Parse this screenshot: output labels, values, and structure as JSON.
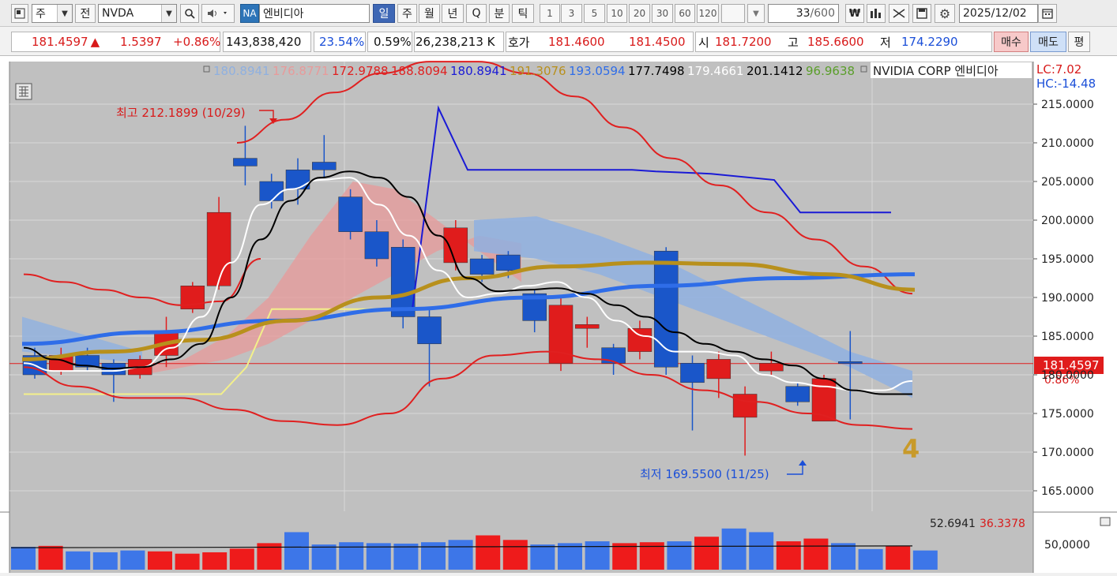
{
  "toolbar": {
    "period_type": "주",
    "prev_label": "전",
    "symbol": "NVDA",
    "exchange_badge": "NA",
    "stock_name": "엔비디아",
    "period_tabs": [
      "일",
      "주",
      "월",
      "년",
      "Q",
      "분",
      "틱"
    ],
    "active_period": "일",
    "intervals": [
      "1",
      "3",
      "5",
      "10",
      "20",
      "30",
      "60",
      "120"
    ],
    "count": "33",
    "count_max": "/600",
    "date": "2025/12/02"
  },
  "quote": {
    "price": "181.4597",
    "change_arrow": "▲",
    "change": "1.5397",
    "change_pct": "+0.86%",
    "volume": "143,838,420",
    "vol_ratio": "23.54%",
    "turnover_ratio": "0.59%",
    "amount": "26,238,213 K",
    "hoga_label": "호가",
    "ask": "181.4600",
    "bid": "181.4500",
    "open_label": "시",
    "open": "181.7200",
    "high_label": "고",
    "high": "185.6600",
    "low_label": "저",
    "low": "174.2290",
    "buy_label": "매수",
    "sell_label": "매도",
    "avg_label": "평"
  },
  "legend": {
    "items": [
      {
        "text": "180.8941",
        "color": "#8fb0e0"
      },
      {
        "text": "176.8771",
        "color": "#e89a9a"
      },
      {
        "text": "172.9788",
        "color": "#e02020"
      },
      {
        "text": "188.8094",
        "color": "#e02020"
      },
      {
        "text": "180.8941",
        "color": "#1a1ad6"
      },
      {
        "text": "191.3076",
        "color": "#b8901c"
      },
      {
        "text": "193.0594",
        "color": "#2f6de8"
      },
      {
        "text": "177.7498",
        "color": "#000000"
      },
      {
        "text": "179.4661",
        "color": "#ffffff"
      },
      {
        "text": "201.1412",
        "color": "#000000"
      },
      {
        "text": "96.9638",
        "color": "#5a9e2a"
      }
    ],
    "name": "NVIDIA CORP  엔비디아",
    "lc": "LC:7.02",
    "hc": "HC:-14.48"
  },
  "annotations": {
    "high": "최고 212.1899 (10/29)",
    "low": "최저 169.5500 (11/25)",
    "count_mark": "4",
    "price_tag": "181.4597",
    "pct_tag": "0.86%"
  },
  "volume_legend": {
    "v1": "52.6941",
    "v2": "36.3378",
    "axis_label": "50,0000"
  },
  "chart_data": {
    "type": "candlestick",
    "ylim": [
      162,
      222
    ],
    "yticks": [
      "215.0000",
      "210.0000",
      "205.0000",
      "200.0000",
      "195.0000",
      "190.0000",
      "185.0000",
      "180.0000",
      "175.0000",
      "170.0000",
      "165.0000"
    ],
    "ytick_values": [
      215,
      210,
      205,
      200,
      195,
      190,
      185,
      180,
      175,
      170,
      165
    ],
    "last_price": 181.4597,
    "candles": [
      {
        "o": 182.5,
        "c": 180.0,
        "h": 183.5,
        "l": 179.5
      },
      {
        "o": 180.5,
        "c": 182.5,
        "h": 183.5,
        "l": 180.0
      },
      {
        "o": 182.5,
        "c": 181.0,
        "h": 183.5,
        "l": 180.5
      },
      {
        "o": 181.5,
        "c": 180.0,
        "h": 182.0,
        "l": 176.5
      },
      {
        "o": 180.0,
        "c": 182.0,
        "h": 182.5,
        "l": 179.5
      },
      {
        "o": 182.5,
        "c": 185.5,
        "h": 187.5,
        "l": 181.0
      },
      {
        "o": 188.5,
        "c": 191.5,
        "h": 192.0,
        "l": 188.0
      },
      {
        "o": 191.5,
        "c": 201.0,
        "h": 203.0,
        "l": 191.0
      },
      {
        "o": 208.0,
        "c": 207.0,
        "h": 212.2,
        "l": 204.5
      },
      {
        "o": 205.0,
        "c": 202.5,
        "h": 206.0,
        "l": 201.5
      },
      {
        "o": 206.5,
        "c": 204.0,
        "h": 208.0,
        "l": 202.0
      },
      {
        "o": 207.5,
        "c": 206.5,
        "h": 211.0,
        "l": 205.5
      },
      {
        "o": 203.0,
        "c": 198.5,
        "h": 204.0,
        "l": 197.5
      },
      {
        "o": 198.5,
        "c": 195.0,
        "h": 200.0,
        "l": 194.0
      },
      {
        "o": 196.5,
        "c": 187.5,
        "h": 197.5,
        "l": 186.0
      },
      {
        "o": 187.5,
        "c": 184.0,
        "h": 188.5,
        "l": 178.5
      },
      {
        "o": 194.5,
        "c": 199.0,
        "h": 200.0,
        "l": 193.5
      },
      {
        "o": 195.0,
        "c": 193.0,
        "h": 195.5,
        "l": 192.0
      },
      {
        "o": 195.5,
        "c": 193.5,
        "h": 196.0,
        "l": 192.5
      },
      {
        "o": 190.5,
        "c": 187.0,
        "h": 191.0,
        "l": 185.5
      },
      {
        "o": 181.5,
        "c": 189.0,
        "h": 190.0,
        "l": 180.5
      },
      {
        "o": 186.0,
        "c": 186.5,
        "h": 187.5,
        "l": 183.5
      },
      {
        "o": 183.5,
        "c": 181.5,
        "h": 184.0,
        "l": 180.0
      },
      {
        "o": 183.0,
        "c": 186.0,
        "h": 187.0,
        "l": 182.0
      },
      {
        "o": 196.0,
        "c": 181.0,
        "h": 196.5,
        "l": 180.0
      },
      {
        "o": 181.5,
        "c": 179.0,
        "h": 182.5,
        "l": 172.8
      },
      {
        "o": 179.5,
        "c": 182.0,
        "h": 183.0,
        "l": 177.0
      },
      {
        "o": 174.5,
        "c": 177.5,
        "h": 178.5,
        "l": 169.55
      },
      {
        "o": 180.5,
        "c": 181.5,
        "h": 183.0,
        "l": 180.0
      },
      {
        "o": 178.5,
        "c": 176.5,
        "h": 179.0,
        "l": 176.0
      },
      {
        "o": 174.0,
        "c": 179.5,
        "h": 180.0,
        "l": 174.0
      },
      {
        "o": 181.7,
        "c": 181.46,
        "h": 185.66,
        "l": 174.23
      }
    ],
    "ma_black": [
      183.5,
      182.0,
      181.2,
      180.8,
      181.0,
      182.0,
      184.0,
      190.0,
      197.5,
      202.5,
      205.5,
      206.3,
      205.5,
      203.0,
      198.0,
      192.5,
      190.8,
      191.0,
      191.2,
      190.5,
      189.0,
      187.5,
      185.5,
      184.0,
      183.0,
      182.0,
      181.2,
      179.5,
      178.0,
      177.5,
      177.5
    ],
    "ma_white": [
      181.5,
      180.5,
      180.5,
      180.5,
      181.0,
      183.5,
      187.5,
      194.5,
      202.0,
      204.0,
      205.2,
      205.5,
      202.0,
      198.0,
      193.5,
      190.0,
      190.5,
      191.5,
      192.0,
      190.0,
      187.0,
      185.0,
      183.0,
      183.0,
      182.5,
      180.0,
      179.0,
      178.5,
      178.0,
      178.0,
      179.2
    ],
    "bb_upper": [
      210.0,
      213.0,
      216.5,
      219.0,
      220.5,
      220.5,
      219.0,
      216.0,
      212.0,
      208.0,
      204.5,
      201.0,
      197.5,
      194.0,
      190.5
    ],
    "bb_lower": [
      181.0,
      178.5,
      177.0,
      177.0,
      175.5,
      174.0,
      173.5,
      175.0,
      179.5,
      182.5,
      183.0,
      182.0,
      180.0,
      178.0,
      176.5,
      175.0,
      173.5,
      173.0
    ],
    "envelope_upper": [
      193.0,
      192.0,
      191.0,
      190.0,
      189.0,
      189.5,
      195.0
    ],
    "envelope_lower": [
      182.0,
      179.5,
      177.0,
      176.5,
      175.5,
      174.5,
      173.5
    ],
    "blue_step": [
      188.0,
      214.5,
      206.5,
      206.5,
      206.0,
      205.5,
      201.0,
      201.0
    ],
    "yellow_step": [
      177.5,
      177.5,
      188.5,
      188.5
    ],
    "ma_gold": [
      182.0,
      183.0,
      184.5,
      187.0,
      190.0,
      192.5,
      194.0,
      194.5,
      194.3,
      193.0,
      191.0
    ],
    "ma_blue": [
      184.0,
      185.5,
      187.0,
      188.5,
      190.0,
      191.5,
      192.5,
      193.0
    ],
    "volume": {
      "values": [
        50,
        52,
        40,
        38,
        42,
        40,
        35,
        38,
        46,
        58,
        82,
        55,
        60,
        58,
        57,
        60,
        65,
        75,
        65,
        55,
        58,
        62,
        58,
        60,
        62,
        72,
        90,
        82,
        62,
        68,
        58,
        45,
        52,
        42
      ],
      "colors": [
        "b",
        "r",
        "b",
        "b",
        "b",
        "r",
        "r",
        "r",
        "r",
        "r",
        "b",
        "b",
        "b",
        "b",
        "b",
        "b",
        "b",
        "r",
        "r",
        "b",
        "b",
        "b",
        "r",
        "r",
        "b",
        "r",
        "b",
        "b",
        "r",
        "r",
        "b",
        "b",
        "r",
        "b"
      ]
    }
  }
}
